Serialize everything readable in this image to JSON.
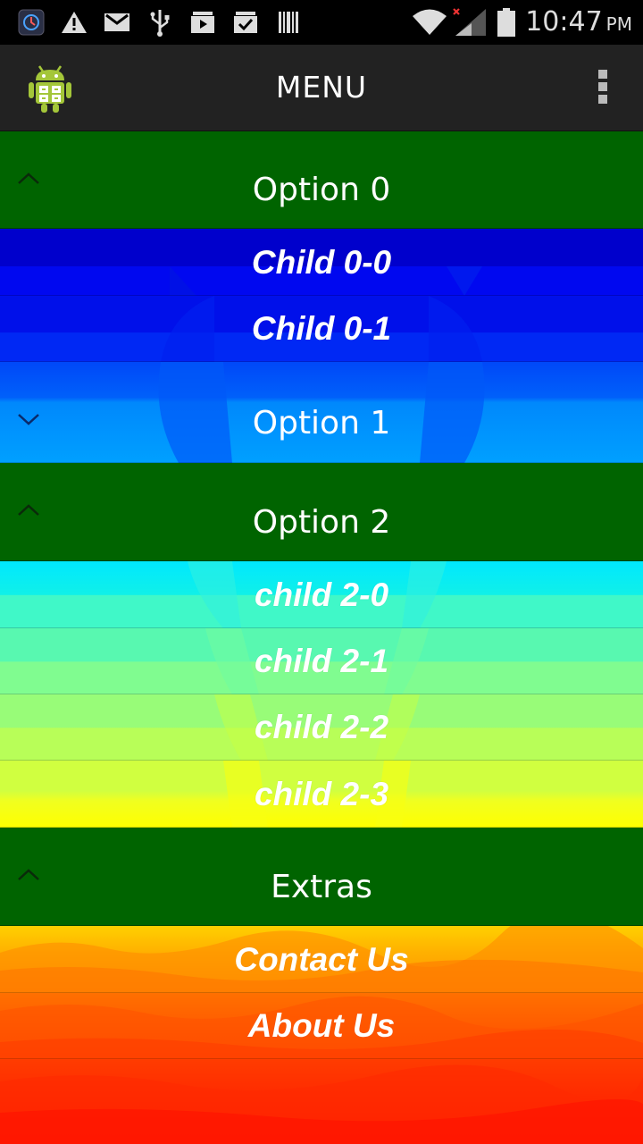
{
  "status_bar": {
    "time": "10:47",
    "ampm": "PM",
    "icons": [
      "app-notification-icon",
      "warning-icon",
      "gmail-icon",
      "usb-icon",
      "media-play-icon",
      "clipboard-check-icon",
      "barcode-icon",
      "wifi-icon",
      "signal-no-data-icon",
      "battery-icon"
    ]
  },
  "action_bar": {
    "title": "MENU",
    "app_icon": "android-calculator-icon",
    "overflow_icon": "overflow-menu-icon"
  },
  "groups": [
    {
      "label": "Option 0",
      "expanded": true,
      "children": [
        "Child 0-0",
        "Child 0-1"
      ]
    },
    {
      "label": "Option 1",
      "expanded": false,
      "children": []
    },
    {
      "label": "Option 2",
      "expanded": true,
      "children": [
        "child 2-0",
        "child 2-1",
        "child 2-2",
        "child 2-3"
      ]
    },
    {
      "label": "Extras",
      "expanded": true,
      "children": [
        "Contact Us",
        "About Us"
      ]
    }
  ],
  "colors": {
    "group_header": "#006400",
    "action_bar": "#222222",
    "status_bar": "#000000"
  }
}
